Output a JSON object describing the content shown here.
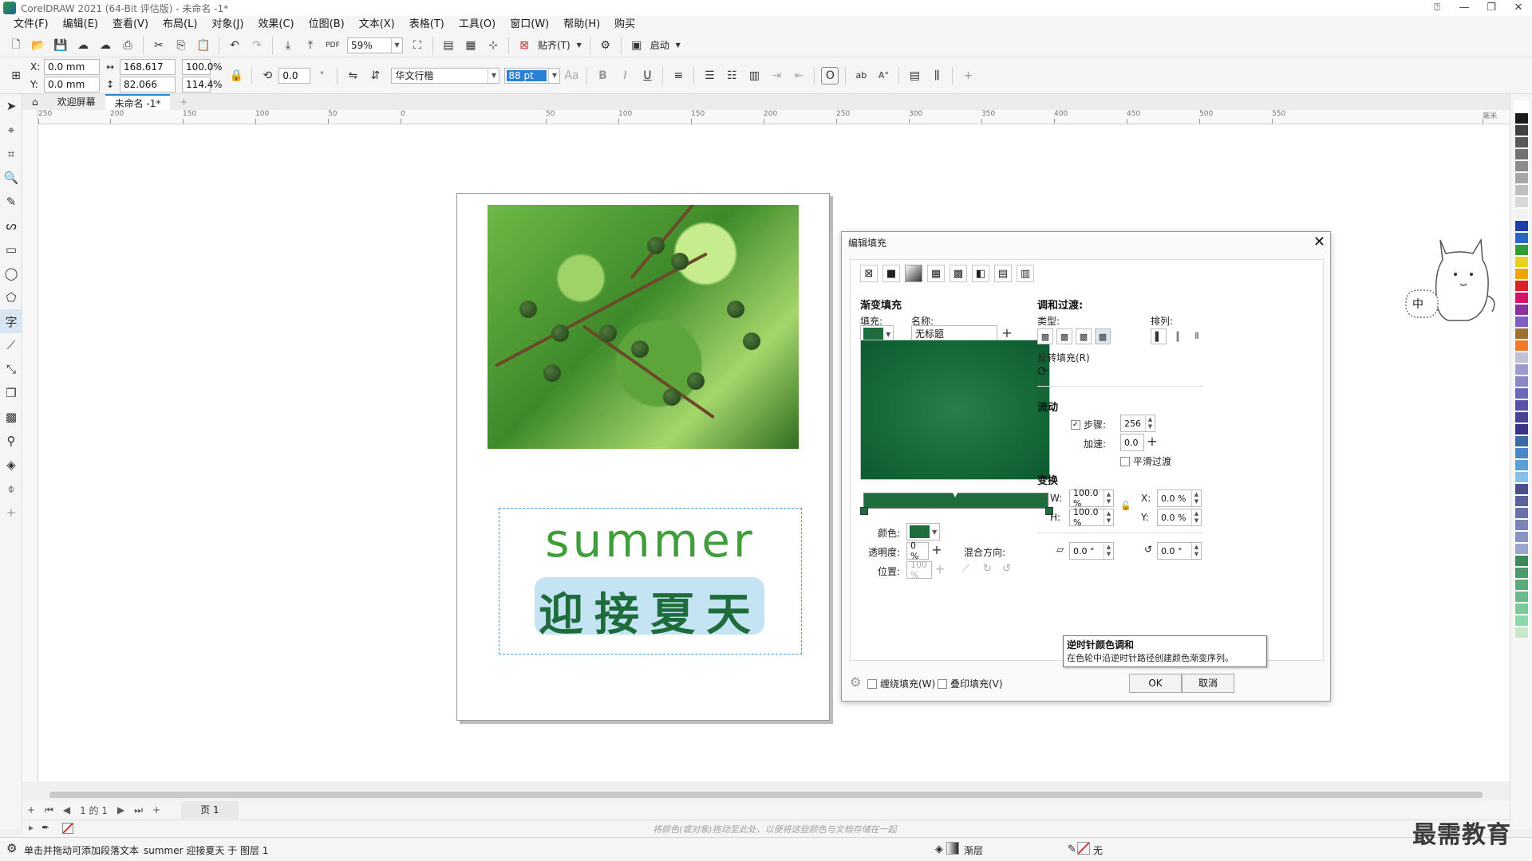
{
  "window": {
    "title": "CorelDRAW 2021 (64-Bit 评估版) - 未命名 -1*"
  },
  "menu": [
    "文件(F)",
    "编辑(E)",
    "查看(V)",
    "布局(L)",
    "对象(J)",
    "效果(C)",
    "位图(B)",
    "文本(X)",
    "表格(T)",
    "工具(O)",
    "窗口(W)",
    "帮助(H)",
    "购买"
  ],
  "toolbar1": {
    "zoom": "59%",
    "snap": "贴齐(T)",
    "launch": "启动"
  },
  "toolbar2": {
    "x_label": "X:",
    "y_label": "Y:",
    "x": "0.0 mm",
    "y": "0.0 mm",
    "w": "168.617 mm",
    "h": "82.066 mm",
    "scale_w": "100.0",
    "scale_h": "114.4",
    "pct": "%",
    "rotate": "0.0",
    "font_name": "华文行楷",
    "font_size": "88 pt"
  },
  "doc_tabs": [
    "欢迎屏幕",
    "未命名 -1*"
  ],
  "ruler_ticks": [
    "250",
    "200",
    "150",
    "100",
    "50",
    "0",
    "50",
    "100",
    "150",
    "200",
    "250",
    "300",
    "350",
    "400",
    "450",
    "500",
    "550",
    "毫米"
  ],
  "artwork": {
    "english": "summer",
    "chinese": "迎接夏天"
  },
  "dialog": {
    "title": "编辑填充",
    "section_gradient": "渐变填充",
    "fill_label": "填充:",
    "name_label": "名称:",
    "name_value": "无标题",
    "blend_section": "调和过渡:",
    "type_label": "类型:",
    "arrange_label": "排列:",
    "reverse_label": "反转填充(R)",
    "flow_section": "流动",
    "steps_label": "步骤:",
    "steps_value": "256",
    "accel_label": "加速:",
    "accel_value": "0.0",
    "smooth_label": "平滑过渡",
    "transform_section": "变换",
    "w_label": "W:",
    "w_value": "100.0 %",
    "h_label": "H:",
    "h_value": "100.0 %",
    "x_label": "X:",
    "x_value": "0.0 %",
    "y_label": "Y:",
    "y_value": "0.0 %",
    "skew_value": "0.0 °",
    "rotate_value": "0.0 °",
    "color_label": "颜色:",
    "transparency_label": "透明度:",
    "transparency_value": "0 %",
    "position_label": "位置:",
    "position_value": "100 %",
    "blend_dir_label": "混合方向:",
    "wrap_fill": "缠绕填充(W)",
    "overprint_fill": "叠印填充(V)",
    "ok": "OK",
    "cancel": "取消",
    "tooltip_title": "逆时针颜色调和",
    "tooltip_body": "在色轮中沿逆时针路径创建颜色渐变序列。",
    "fill_color": "#1e6e3d"
  },
  "pagebar": {
    "page_counter": "1 的 1",
    "page_tab": "页 1"
  },
  "docpalette_hint": "将颜色(或对象)拖动至此处，以便将这些颜色与文档存储在一起",
  "status": {
    "hint": "单击并拖动可添加段落文本",
    "object": "summer 迎接夏天 于 图层 1",
    "fill": "渐层",
    "outline": "无"
  },
  "watermark": "最需教育",
  "mascot_text": "中",
  "palette_colors": [
    "#ffffff",
    "#1a1a1a",
    "#404040",
    "#595959",
    "#737373",
    "#8c8c8c",
    "#a6a6a6",
    "#bfbfbf",
    "#d9d9d9",
    "#f2f2f2",
    "#1f3fa8",
    "#2a66c4",
    "#2f9e3a",
    "#e8d21a",
    "#f5a300",
    "#e01e2b",
    "#d4146a",
    "#8a2f9e",
    "#7f5fc4",
    "#a07030",
    "#f07a2a",
    "#c0c0d8",
    "#9c9cd0",
    "#8b87c8",
    "#6a66b8",
    "#5852a8",
    "#474292",
    "#38348a",
    "#3a6aa8",
    "#4a86c8",
    "#5aa0d8",
    "#8ac0e8",
    "#4a4f8a",
    "#5a6098",
    "#6a72a8",
    "#7a84b8",
    "#8a94c4",
    "#9aa6d0",
    "#3a8a5a",
    "#4a9a6a",
    "#5aaa7a",
    "#6aba8a",
    "#7aca9a",
    "#8adaaa",
    "#c8e8c8"
  ]
}
